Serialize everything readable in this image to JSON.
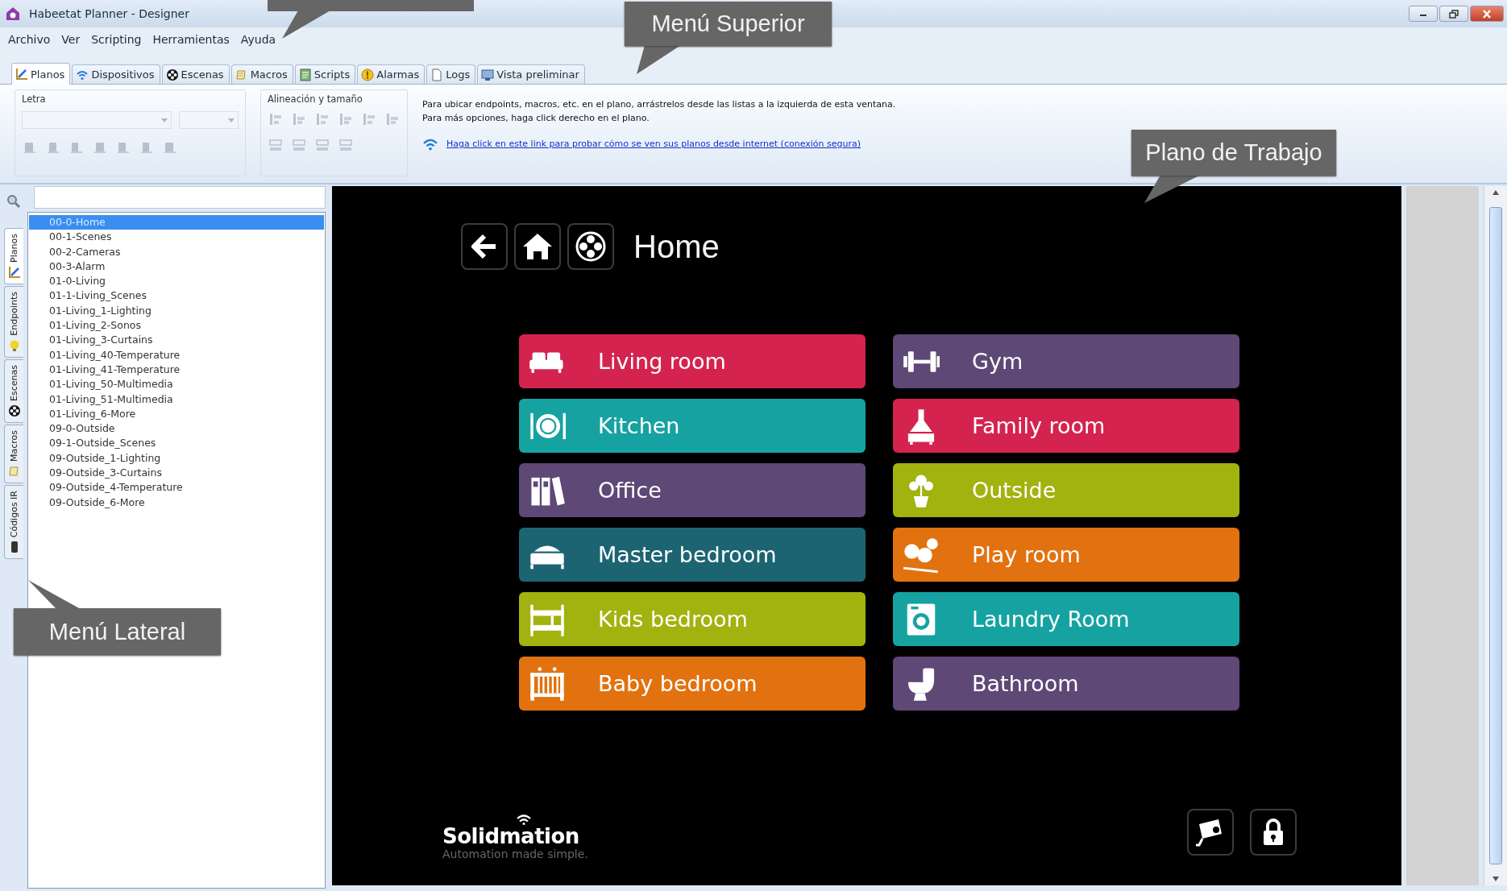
{
  "window": {
    "title": "Habeetat Planner - Designer"
  },
  "menu": [
    "Archivo",
    "Ver",
    "Scripting",
    "Herramientas",
    "Ayuda"
  ],
  "tabs": [
    {
      "label": "Planos",
      "selected": true
    },
    {
      "label": "Dispositivos",
      "selected": false
    },
    {
      "label": "Escenas",
      "selected": false
    },
    {
      "label": "Macros",
      "selected": false
    },
    {
      "label": "Scripts",
      "selected": false
    },
    {
      "label": "Alarmas",
      "selected": false
    },
    {
      "label": "Logs",
      "selected": false
    },
    {
      "label": "Vista preliminar",
      "selected": false
    }
  ],
  "ribbon": {
    "groups": [
      {
        "title": "Letra",
        "disabled": true
      },
      {
        "title": "Alineación y tamaño",
        "disabled": true
      }
    ],
    "hints": [
      "Para ubicar endpoints, macros, etc. en el plano, arrástrelos desde las listas a la izquierda de esta ventana.",
      "Para más opciones, haga click derecho en el plano."
    ],
    "link": "Haga click en este link para probar cómo se ven sus planos desde internet (conexión segura)"
  },
  "side_tabs": [
    {
      "label": "Planos",
      "selected": true
    },
    {
      "label": "Endpoints",
      "selected": false
    },
    {
      "label": "Escenas",
      "selected": false
    },
    {
      "label": "Macros",
      "selected": false
    },
    {
      "label": "Códigos IR",
      "selected": false
    }
  ],
  "tree": {
    "items": [
      {
        "label": "00-0-Home",
        "selected": true
      },
      {
        "label": "00-1-Scenes",
        "selected": false
      },
      {
        "label": "00-2-Cameras",
        "selected": false
      },
      {
        "label": "00-3-Alarm",
        "selected": false
      },
      {
        "label": "01-0-Living",
        "selected": false
      },
      {
        "label": "01-1-Living_Scenes",
        "selected": false
      },
      {
        "label": "01-Living_1-Lighting",
        "selected": false
      },
      {
        "label": "01-Living_2-Sonos",
        "selected": false
      },
      {
        "label": "01-Living_3-Curtains",
        "selected": false
      },
      {
        "label": "01-Living_40-Temperature",
        "selected": false
      },
      {
        "label": "01-Living_41-Temperature",
        "selected": false
      },
      {
        "label": "01-Living_50-Multimedia",
        "selected": false
      },
      {
        "label": "01-Living_51-Multimedia",
        "selected": false
      },
      {
        "label": "01-Living_6-More",
        "selected": false
      },
      {
        "label": "09-0-Outside",
        "selected": false
      },
      {
        "label": "09-1-Outside_Scenes",
        "selected": false
      },
      {
        "label": "09-Outside_1-Lighting",
        "selected": false
      },
      {
        "label": "09-Outside_3-Curtains",
        "selected": false
      },
      {
        "label": "09-Outside_4-Temperature",
        "selected": false
      },
      {
        "label": "09-Outside_6-More",
        "selected": false
      }
    ]
  },
  "canvas": {
    "title": "Home",
    "tiles": [
      {
        "label": "Living room",
        "color": "#d4234f"
      },
      {
        "label": "Gym",
        "color": "#5e4876"
      },
      {
        "label": "Kitchen",
        "color": "#17a2a2"
      },
      {
        "label": "Family room",
        "color": "#d4234f"
      },
      {
        "label": "Office",
        "color": "#5e4876"
      },
      {
        "label": "Outside",
        "color": "#a2b20f"
      },
      {
        "label": "Master bedroom",
        "color": "#1d6473"
      },
      {
        "label": "Play room",
        "color": "#e2720f"
      },
      {
        "label": "Kids bedroom",
        "color": "#a2b20f"
      },
      {
        "label": "Laundry Room",
        "color": "#17a2a2"
      },
      {
        "label": "Baby bedroom",
        "color": "#e2720f"
      },
      {
        "label": "Bathroom",
        "color": "#5e4876"
      }
    ],
    "logo": {
      "name": "Solidmation",
      "tagline": "Automation made simple."
    }
  },
  "callouts": [
    "Menú Superior",
    "Plano de Trabajo",
    "Menú Lateral"
  ]
}
